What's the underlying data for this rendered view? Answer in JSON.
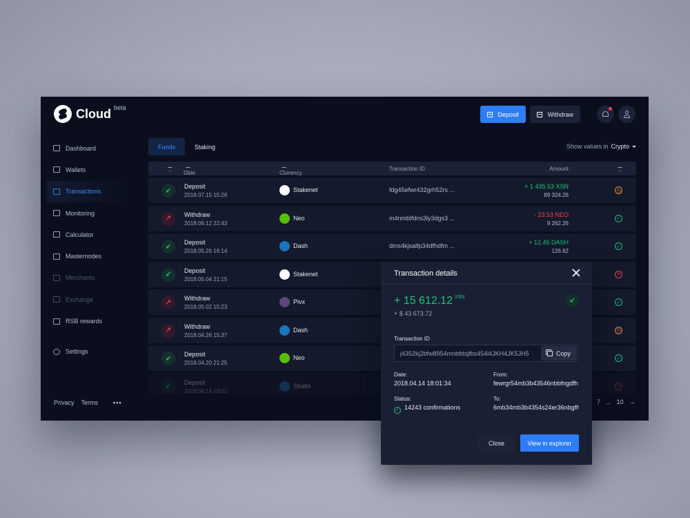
{
  "app": {
    "name": "Cloud",
    "badge": "beta"
  },
  "header": {
    "deposit_label": "Deposit",
    "withdraw_label": "Withdraw"
  },
  "sidebar": {
    "items": [
      {
        "label": "Dashboard",
        "icon": "dashboard-icon"
      },
      {
        "label": "Wallets",
        "icon": "wallet-icon"
      },
      {
        "label": "Transactions",
        "icon": "transactions-icon"
      },
      {
        "label": "Monitoring",
        "icon": "monitoring-icon"
      },
      {
        "label": "Calculator",
        "icon": "calculator-icon"
      },
      {
        "label": "Masternodes",
        "icon": "masternodes-icon"
      },
      {
        "label": "Merchants",
        "icon": "merchants-icon"
      },
      {
        "label": "Exchange",
        "icon": "exchange-icon"
      },
      {
        "label": "RSB rewards",
        "icon": "rewards-icon"
      }
    ],
    "settings_label": "Settings",
    "footer": {
      "privacy": "Privacy",
      "terms": "Terms",
      "more": "•••"
    }
  },
  "tabs": {
    "funds": "Funds",
    "staking": "Staking"
  },
  "show_values": {
    "label": "Show values in",
    "value": "Crypto"
  },
  "table": {
    "headers": {
      "date": "Date",
      "currency": "Currency",
      "txid": "Transaction ID",
      "amount": "Amount"
    },
    "rows": [
      {
        "type": "Deposit",
        "date": "2018.07.15 15:26",
        "currency": "Stakenet",
        "txid": "fdg45efwr432grh52rs ...",
        "amount": "+ 1 435.53 XSN",
        "usd": "89 324.26",
        "status": "pending"
      },
      {
        "type": "Withdraw",
        "date": "2018.06.12 22:43",
        "currency": "Neo",
        "txid": "m4nmblfdns3ly3dgs3 ...",
        "amount": "- 23.53 NEO",
        "usd": "9 262.26",
        "status": "ok"
      },
      {
        "type": "Deposit",
        "date": "2018.05.26 16:14",
        "currency": "Dash",
        "txid": "dms4kjsalfp34dfhdfm ...",
        "amount": "+ 12.45 DASH",
        "usd": "126.62",
        "status": "ok"
      },
      {
        "type": "Deposit",
        "date": "2018.05.04 21:15",
        "currency": "Stakenet",
        "status": "fail"
      },
      {
        "type": "Withdraw",
        "date": "2018.05.02 15:23",
        "currency": "Pivx",
        "status": "ok"
      },
      {
        "type": "Withdraw",
        "date": "2018.04.26 15:37",
        "currency": "Dash",
        "status": "pending"
      },
      {
        "type": "Deposit",
        "date": "2018.04.20 21:25",
        "currency": "Neo",
        "status": "ok"
      },
      {
        "type": "Deposit",
        "date": "2018.04.14 18:01",
        "currency": "Stratis",
        "status": "fail"
      }
    ]
  },
  "pagination": {
    "page": "7",
    "ellipsis": "...",
    "last": "10",
    "next": "→"
  },
  "modal": {
    "title": "Transaction details",
    "amount": "+ 15 612.12",
    "amount_unit": "XSN",
    "usd": "+ $ 43 673.72",
    "txid_label": "Transaction ID",
    "txid": "j4352kj2bfw8954mnbfdsjfbs454l4JKH4JK5JH5",
    "copy_label": "Copy",
    "date_label": "Date:",
    "date": "2018.04.14 18:01:34",
    "from_label": "From:",
    "from": "fewrgr54mb3b43546nbbfngdfh",
    "status_label": "Status:",
    "status": "14243 confirmations",
    "to_label": "To:",
    "to": "6mb34mb3b4354s24er36nbgfh",
    "close_label": "Close",
    "view_label": "View in explorer"
  },
  "colors": {
    "accent": "#2d7df6",
    "positive": "#22c07a",
    "negative": "#f0444f",
    "pending": "#f08a44",
    "stakenet": "#ffffff",
    "neo": "#58bf00",
    "dash": "#1c75bc",
    "pivx": "#5e4778"
  }
}
